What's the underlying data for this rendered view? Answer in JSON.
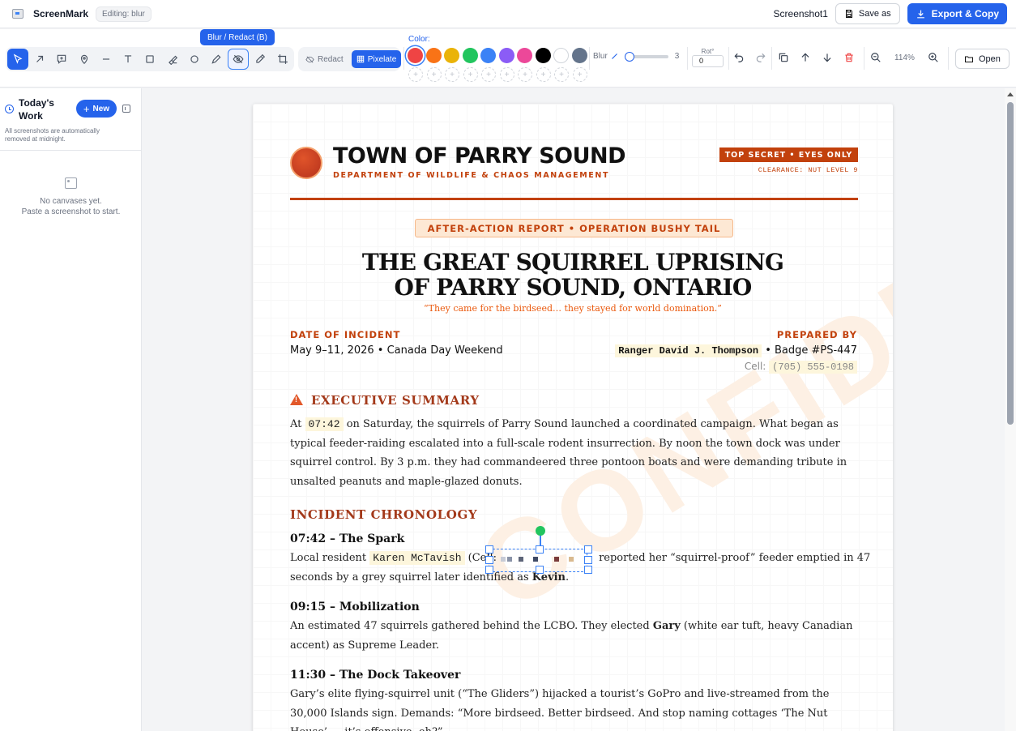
{
  "app": {
    "name": "ScreenMark",
    "editing_badge": "Editing: blur",
    "document_name": "Screenshot1",
    "save_label": "Save as",
    "export_label": "Export & Copy"
  },
  "toolbar": {
    "tools": [
      "select-icon",
      "arrow-icon",
      "callout-icon",
      "pin-icon",
      "line-icon",
      "text-icon",
      "rectangle-icon",
      "highlighter-icon",
      "ellipse-icon",
      "pen-icon",
      "blur-redact-icon",
      "eyedropper-icon",
      "crop-icon"
    ],
    "tooltip": "Blur / Redact (B)",
    "redact_label": "Redact",
    "pixelate_label": "Pixelate",
    "color_label": "Color:",
    "colors": [
      "#ef4444",
      "#f97316",
      "#eab308",
      "#22c55e",
      "#3b82f6",
      "#8b5cf6",
      "#ec4899",
      "#000000",
      "#ffffff",
      "#64748b"
    ],
    "selected_color": "#ef4444",
    "blur_label": "Blur",
    "blur_value": "3",
    "rot_label": "Rot°",
    "rot_value": "0",
    "zoom": "114%",
    "open_label": "Open"
  },
  "sidebar": {
    "title": "Today's Work",
    "new_label": "New",
    "note": "All screenshots are automatically removed at midnight.",
    "empty_line1": "No canvases yet.",
    "empty_line2": "Paste a screenshot to start."
  },
  "document": {
    "town": "TOWN OF PARRY SOUND",
    "department": "DEPARTMENT OF WILDLIFE & CHAOS MANAGEMENT",
    "classification": "TOP SECRET • EYES ONLY",
    "clearance": "CLEARANCE: NUT LEVEL 9",
    "report_badge": "AFTER-ACTION REPORT • OPERATION BUSHY TAIL",
    "title_line1": "THE GREAT SQUIRREL UPRISING",
    "title_line2": "OF PARRY SOUND, ONTARIO",
    "tagline": "“They came for the birdseed… they stayed for world domination.”",
    "date_label": "DATE OF INCIDENT",
    "date_value": "May 9–11, 2026 • Canada Day Weekend",
    "prepared_label": "PREPARED BY",
    "prepared_name": "Ranger David J. Thompson",
    "prepared_badge": "• Badge #PS-447",
    "cell_label": "Cell:",
    "cell_value": "(705) 555-0198",
    "watermark": "CONFIDENTIAL",
    "exec_heading": "EXECUTIVE SUMMARY",
    "exec_time": "07:42",
    "exec_text": "on Saturday, the squirrels of Parry Sound launched a coordinated campaign. What began as typical feeder-raiding escalated into a full-scale rodent insurrection. By noon the town dock was under squirrel control. By 3 p.m. they had commandeered three pontoon boats and were demanding tribute in unsalted peanuts and maple-glazed donuts.",
    "exec_prefix": "At",
    "chrono_heading": "INCIDENT CHRONOLOGY",
    "entries": [
      {
        "heading": "07:42 – The Spark",
        "pre": "Local resident",
        "name": "Karen McTavish",
        "cell": "(Cell:",
        "post": "reported her “squirrel-proof” feeder emptied in 47",
        "line2_pre": "seconds by a grey squirrel later identified as",
        "line2_bold": "Kevin",
        "line2_post": "."
      },
      {
        "heading": "09:15 – Mobilization",
        "pre": "An estimated 47 squirrels gathered behind the LCBO. They elected",
        "bold": "Gary",
        "post": "(white ear tuft, heavy Canadian accent) as Supreme Leader."
      },
      {
        "heading": "11:30 – The Dock Takeover",
        "text": "Gary’s elite flying-squirrel unit (“The Gliders”) hijacked a tourist’s GoPro and live-streamed from the 30,000 Islands sign. Demands: “More birdseed. Better birdseed. And stop naming cottages ‘The Nut House’ — it’s offensive, eh?”"
      }
    ]
  }
}
